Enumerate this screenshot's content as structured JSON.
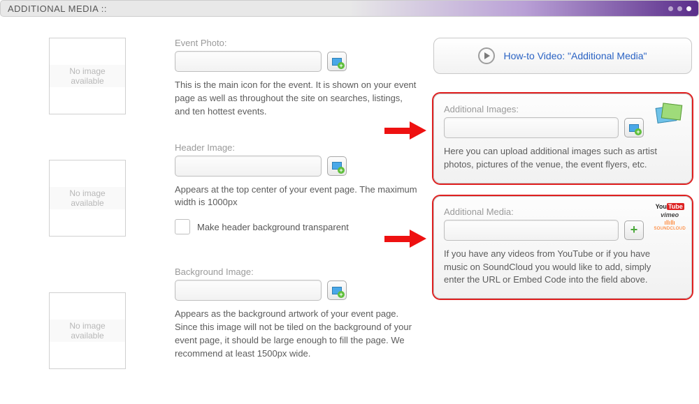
{
  "header": {
    "title": "ADDITIONAL MEDIA ::"
  },
  "thumb": {
    "no_image": "No image available"
  },
  "event_photo": {
    "label": "Event Photo:",
    "help": "This is the main icon for the event. It is shown on your event page as well as throughout the site on searches, listings, and ten hottest events."
  },
  "header_image": {
    "label": "Header Image:",
    "help": "Appears at the top center of your event page. The maximum width is 1000px",
    "checkbox_label": "Make header background transparent"
  },
  "background_image": {
    "label": "Background Image:",
    "help": "Appears as the background artwork of your event page. Since this image will not be tiled on the background of your event page, it should be large enough to fill the page. We recommend at least 1500px wide."
  },
  "howto": {
    "text": "How-to Video: \"Additional Media\""
  },
  "additional_images": {
    "label": "Additional Images:",
    "help": "Here you can upload additional images such as artist photos, pictures of the venue, the event flyers, etc."
  },
  "additional_media": {
    "label": "Additional Media:",
    "help": "If you have any videos from YouTube or if you have music on SoundCloud you would like to add, simply enter the URL or Embed Code into the field above."
  },
  "logos": {
    "youtube_a": "You",
    "youtube_b": "Tube",
    "vimeo": "vimeo",
    "soundcloud": "SOUNDCLOUD"
  }
}
